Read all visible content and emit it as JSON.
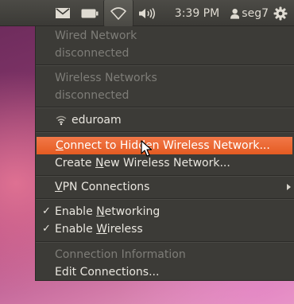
{
  "panel": {
    "clock": "3:39 PM",
    "user": "seg7",
    "icons": [
      "envelope-icon",
      "battery-icon",
      "wifi-icon",
      "speaker-icon",
      "user-icon",
      "power-gear-icon"
    ]
  },
  "menu": {
    "wired_header": "Wired Network",
    "wired_status": "disconnected",
    "wireless_header": "Wireless Networks",
    "wireless_status": "disconnected",
    "network_name": "eduroam",
    "connect_hidden": {
      "pre": "",
      "mnemonic": "C",
      "post": "onnect to Hidden Wireless Network..."
    },
    "create_new": {
      "pre": "Create ",
      "mnemonic": "N",
      "post": "ew Wireless Network..."
    },
    "vpn": {
      "pre": "",
      "mnemonic": "V",
      "post": "PN Connections"
    },
    "enable_networking": {
      "pre": "Enable ",
      "mnemonic": "N",
      "post": "etworking",
      "checked": true
    },
    "enable_wireless": {
      "pre": "Enable ",
      "mnemonic": "W",
      "post": "ireless",
      "checked": true
    },
    "connection_info": "Connection Information",
    "edit_connections": "Edit Connections..."
  },
  "colors": {
    "highlight": "#e95420",
    "panel_bg": "#3c3b37",
    "menu_text": "#e9e6df",
    "disabled_text": "#7e7d78"
  }
}
